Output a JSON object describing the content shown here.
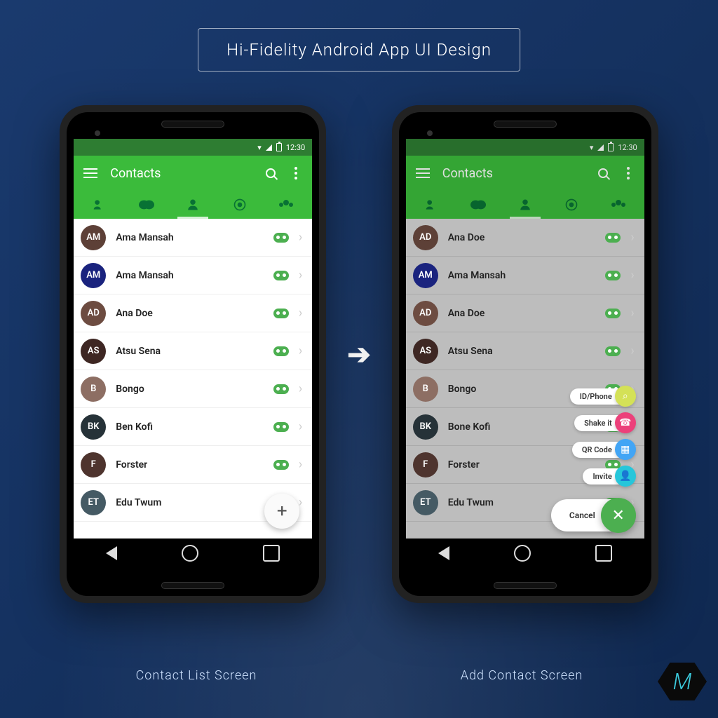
{
  "page_title": "Hi-Fidelity Android App UI Design",
  "status_time": "12:30",
  "app_bar_title": "Contacts",
  "captions": {
    "left": "Contact List Screen",
    "right": "Add Contact Screen"
  },
  "left_contacts": [
    {
      "name": "Ama Mansah",
      "initials": "AM",
      "color": "#5d4037"
    },
    {
      "name": "Ama Mansah",
      "initials": "AM",
      "color": "#1a237e"
    },
    {
      "name": "Ana Doe",
      "initials": "AD",
      "color": "#6d4c41"
    },
    {
      "name": "Atsu Sena",
      "initials": "AS",
      "color": "#3e2723"
    },
    {
      "name": "Bongo",
      "initials": "B",
      "color": "#8d6e63"
    },
    {
      "name": "Ben Kofi",
      "initials": "BK",
      "color": "#263238"
    },
    {
      "name": "Forster",
      "initials": "F",
      "color": "#4e342e"
    },
    {
      "name": "Edu Twum",
      "initials": "ET",
      "color": "#455a64"
    }
  ],
  "right_contacts": [
    {
      "name": "Ana Doe",
      "initials": "AD",
      "color": "#5d4037"
    },
    {
      "name": "Ama Mansah",
      "initials": "AM",
      "color": "#1a237e"
    },
    {
      "name": "Ana Doe",
      "initials": "AD",
      "color": "#6d4c41"
    },
    {
      "name": "Atsu Sena",
      "initials": "AS",
      "color": "#3e2723"
    },
    {
      "name": "Bongo",
      "initials": "B",
      "color": "#8d6e63"
    },
    {
      "name": "Bone Kofi",
      "initials": "BK",
      "color": "#263238"
    },
    {
      "name": "Forster",
      "initials": "F",
      "color": "#4e342e"
    },
    {
      "name": "Edu Twum",
      "initials": "ET",
      "color": "#455a64"
    }
  ],
  "speed_dial": [
    {
      "label": "ID/Phone",
      "color": "#d4e157",
      "icon": "search"
    },
    {
      "label": "Shake it",
      "color": "#ec407a",
      "icon": "phone"
    },
    {
      "label": "QR Code",
      "color": "#42a5f5",
      "icon": "qr"
    },
    {
      "label": "Invite",
      "color": "#26c6da",
      "icon": "person"
    }
  ],
  "cancel_label": "Cancel",
  "logo_letter": "M"
}
